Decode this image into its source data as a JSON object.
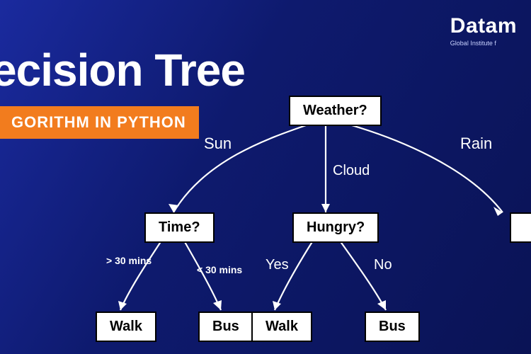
{
  "brand": {
    "name": "Datam",
    "tagline": "Global Institute f"
  },
  "title": "ecision Tree",
  "subtitle": "GORITHM IN PYTHON",
  "tree": {
    "root": "Weather?",
    "root_edges": {
      "left": "Sun",
      "mid": "Cloud",
      "right": "Rain"
    },
    "left": {
      "node": "Time?",
      "edges": {
        "left": "> 30 mins",
        "right": "< 30 mins"
      },
      "leaves": {
        "left": "Walk",
        "right": "Bus"
      }
    },
    "mid": {
      "node": "Hungry?",
      "edges": {
        "left": "Yes",
        "right": "No"
      },
      "leaves": {
        "left": "Walk",
        "right": "Bus"
      }
    }
  }
}
